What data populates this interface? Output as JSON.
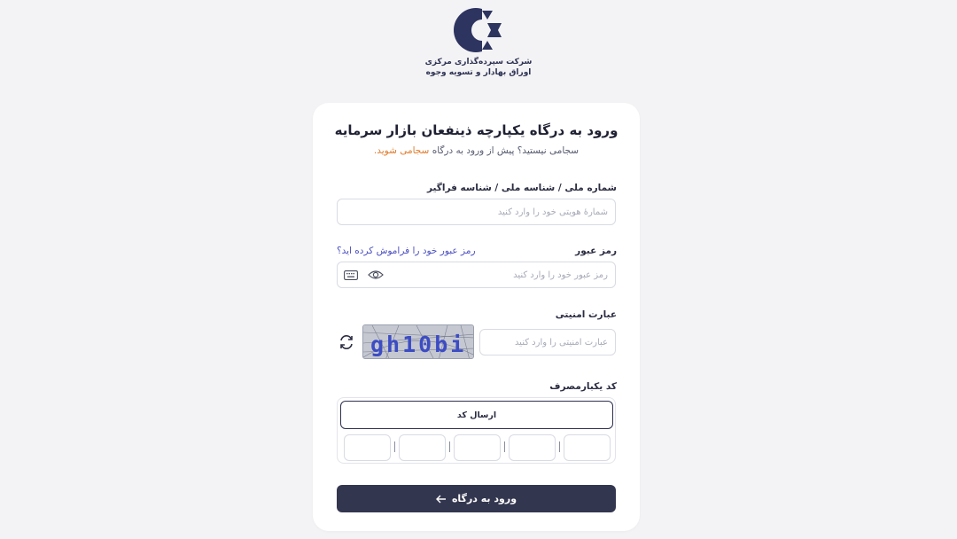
{
  "logo": {
    "line1": "شرکت سپرده‌گذاری مرکزی",
    "line2": "اوراق بهادار و تسویه وجوه"
  },
  "card": {
    "title": "ورود به درگاه یکپارچه ذینفعان بازار سرمایه",
    "subtitle_prefix": "سجامی نیستید؟ پیش از ورود به درگاه ",
    "subtitle_link": "سجامی شوید."
  },
  "identity": {
    "label": "شماره ملی / شناسه ملی / شناسه فراگیر",
    "placeholder": "شمارهٔ هویتی خود را وارد کنید",
    "value": ""
  },
  "password": {
    "label": "رمز عبور",
    "forgot_link": "رمز عبور خود را فراموش کرده اید؟",
    "placeholder": "رمز عبور خود را وارد کنید",
    "value": ""
  },
  "captcha": {
    "label": "عبارت امنیتی",
    "placeholder": "عبارت امنیتی را وارد کنید",
    "value": "",
    "image_text": "gh10bi"
  },
  "otp": {
    "label": "کد یکبارمصرف",
    "send_label": "ارسال کد",
    "digits": [
      "",
      "",
      "",
      "",
      ""
    ]
  },
  "submit": {
    "label": "ورود به درگاه"
  },
  "icons": {
    "eye": "eye-icon",
    "keyboard": "keyboard-icon",
    "refresh": "refresh-icon",
    "arrow": "arrow-left-icon"
  },
  "colors": {
    "background": "#f3f3f5",
    "primary": "#33364f",
    "accent_orange": "#e07b2c",
    "link": "#4a4fbf"
  }
}
